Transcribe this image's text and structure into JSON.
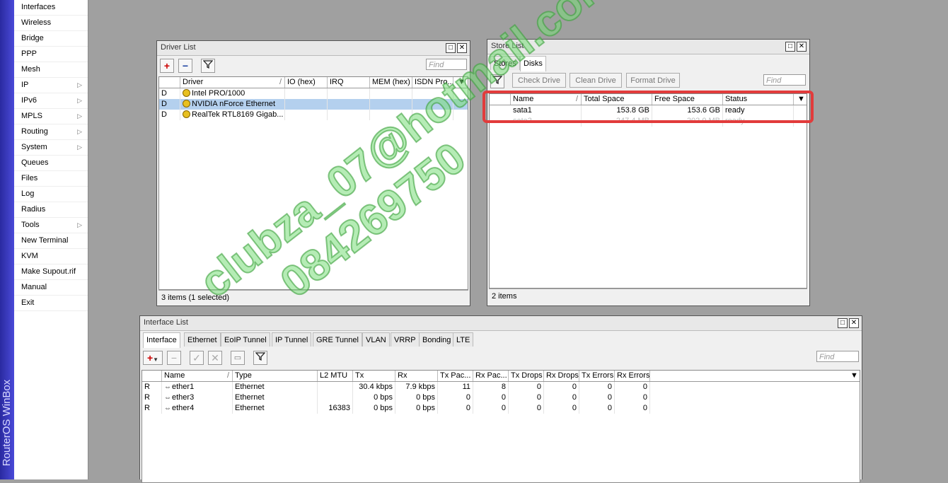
{
  "brand": "RouterOS WinBox",
  "menu": [
    {
      "label": "Interfaces",
      "arrow": false
    },
    {
      "label": "Wireless",
      "arrow": false
    },
    {
      "label": "Bridge",
      "arrow": false
    },
    {
      "label": "PPP",
      "arrow": false
    },
    {
      "label": "Mesh",
      "arrow": false
    },
    {
      "label": "IP",
      "arrow": true
    },
    {
      "label": "IPv6",
      "arrow": true
    },
    {
      "label": "MPLS",
      "arrow": true
    },
    {
      "label": "Routing",
      "arrow": true
    },
    {
      "label": "System",
      "arrow": true
    },
    {
      "label": "Queues",
      "arrow": false
    },
    {
      "label": "Files",
      "arrow": false
    },
    {
      "label": "Log",
      "arrow": false
    },
    {
      "label": "Radius",
      "arrow": false
    },
    {
      "label": "Tools",
      "arrow": true
    },
    {
      "label": "New Terminal",
      "arrow": false
    },
    {
      "label": "KVM",
      "arrow": false
    },
    {
      "label": "Make Supout.rif",
      "arrow": false
    },
    {
      "label": "Manual",
      "arrow": false
    },
    {
      "label": "Exit",
      "arrow": false
    }
  ],
  "driver_list": {
    "title": "Driver List",
    "find_placeholder": "Find",
    "columns": [
      "Driver",
      "IO (hex)",
      "IRQ",
      "MEM (hex)",
      "ISDN Pro..."
    ],
    "rows": [
      {
        "flag": "D",
        "driver": "Intel PRO/1000",
        "selected": false
      },
      {
        "flag": "D",
        "driver": "NVIDIA nForce Ethernet",
        "selected": true
      },
      {
        "flag": "D",
        "driver": "RealTek RTL8169 Gigab...",
        "selected": false
      }
    ],
    "status": "3 items (1 selected)"
  },
  "store_list": {
    "title": "Store List",
    "tabs": [
      "Stores",
      "Disks"
    ],
    "active_tab": "Disks",
    "buttons": [
      "Check Drive",
      "Clean Drive",
      "Format Drive"
    ],
    "find_placeholder": "Find",
    "columns": [
      "Name",
      "Total Space",
      "Free Space",
      "Status"
    ],
    "rows": [
      {
        "name": "sata1",
        "total": "153.8 GB",
        "free": "153.6 GB",
        "status": "ready"
      },
      {
        "name": "sata2",
        "total": "247.4 MB",
        "free": "202.0 MB",
        "status": "ready"
      }
    ],
    "status": "2 items"
  },
  "interface_list": {
    "title": "Interface List",
    "tabs": [
      "Interface",
      "Ethernet",
      "EoIP Tunnel",
      "IP Tunnel",
      "GRE Tunnel",
      "VLAN",
      "VRRP",
      "Bonding",
      "LTE"
    ],
    "active_tab": "Interface",
    "find_placeholder": "Find",
    "columns": [
      "Name",
      "Type",
      "L2 MTU",
      "Tx",
      "Rx",
      "Tx Pac...",
      "Rx Pac...",
      "Tx Drops",
      "Rx Drops",
      "Tx Errors",
      "Rx Errors"
    ],
    "rows": [
      {
        "flag": "R",
        "name": "ether1",
        "type": "Ethernet",
        "l2mtu": "",
        "tx": "30.4 kbps",
        "rx": "7.9 kbps",
        "txp": "11",
        "rxp": "8",
        "txd": "0",
        "rxd": "0",
        "txe": "0",
        "rxe": "0"
      },
      {
        "flag": "R",
        "name": "ether3",
        "type": "Ethernet",
        "l2mtu": "",
        "tx": "0 bps",
        "rx": "0 bps",
        "txp": "0",
        "rxp": "0",
        "txd": "0",
        "rxd": "0",
        "txe": "0",
        "rxe": "0"
      },
      {
        "flag": "R",
        "name": "ether4",
        "type": "Ethernet",
        "l2mtu": "16383",
        "tx": "0 bps",
        "rx": "0 bps",
        "txp": "0",
        "rxp": "0",
        "txd": "0",
        "rxd": "0",
        "txe": "0",
        "rxe": "0"
      }
    ]
  },
  "watermark": {
    "line1": "clubza_07@hotmail.com",
    "line2": "084269750"
  }
}
